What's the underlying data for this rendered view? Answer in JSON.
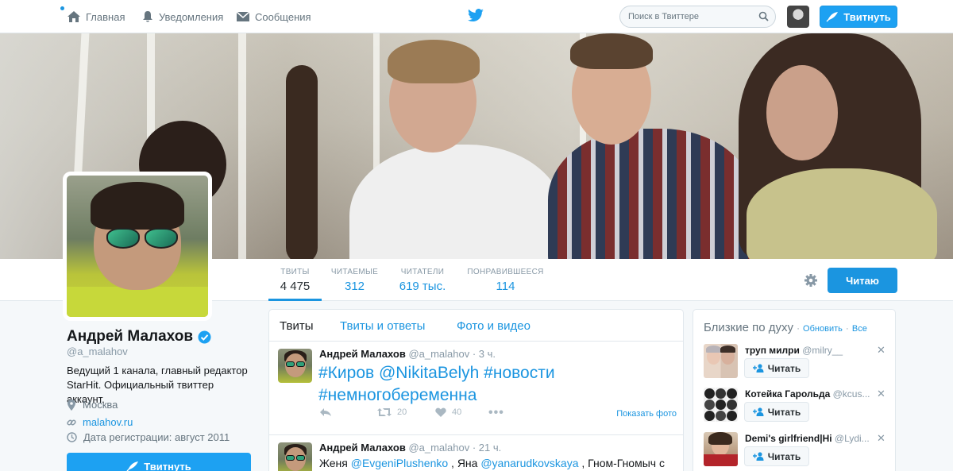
{
  "nav": {
    "home": "Главная",
    "notifications": "Уведомления",
    "messages": "Сообщения",
    "search_placeholder": "Поиск в Твиттере",
    "tweet_button": "Твитнуть"
  },
  "stats": [
    {
      "label": "ТВИТЫ",
      "value": "4 475",
      "active": true
    },
    {
      "label": "ЧИТАЕМЫЕ",
      "value": "312"
    },
    {
      "label": "ЧИТАТЕЛИ",
      "value": "619 тыс."
    },
    {
      "label": "ПОНРАВИВШЕЕСЯ",
      "value": "114"
    }
  ],
  "follow_button": "Читаю",
  "profile": {
    "name": "Андрей Малахов",
    "handle": "@a_malahov",
    "bio": "Ведущий 1 канала, главный редактор StarHit. Официальный твиттер аккаунт.",
    "location": "Москва",
    "website": "malahov.ru",
    "joined": "Дата регистрации: август 2011",
    "tweet_button": "Твитнуть"
  },
  "timeline": {
    "tabs": [
      "Твиты",
      "Твиты и ответы",
      "Фото и видео"
    ],
    "tweets": [
      {
        "name": "Андрей Малахов",
        "handle": "@a_malahov",
        "time": "· 3 ч.",
        "text": "#Киров @NikitaBelyh #новости #немногоберемен­на",
        "text_display": "#Киров @NikitaBelyh #новости #немногоберемен­на",
        "retweets": "20",
        "likes": "40",
        "show_photo": "Показать фото"
      },
      {
        "name": "Андрей Малахов",
        "handle": "@a_malahov",
        "time": "· 21 ч.",
        "text_parts": [
          "Женя ",
          "@EvgeniPlushenko",
          " , Яна ",
          "@yanarudkovskaya",
          " , Гном-Гномыч с"
        ]
      }
    ]
  },
  "who_to_follow": {
    "title": "Близкие по духу",
    "refresh": "Обновить",
    "separator": "·",
    "all": "Все",
    "follow_label": "Читать",
    "items": [
      {
        "name": "труп милри",
        "handle": "@milry__"
      },
      {
        "name": "Котейка Гарольда",
        "handle": "@kcus..."
      },
      {
        "name": "Demi's girlfriend|Hi",
        "handle": "@Lydi..."
      }
    ]
  },
  "colors": {
    "accent": "#1b95e0",
    "tweet_button": "#1da1f2"
  }
}
